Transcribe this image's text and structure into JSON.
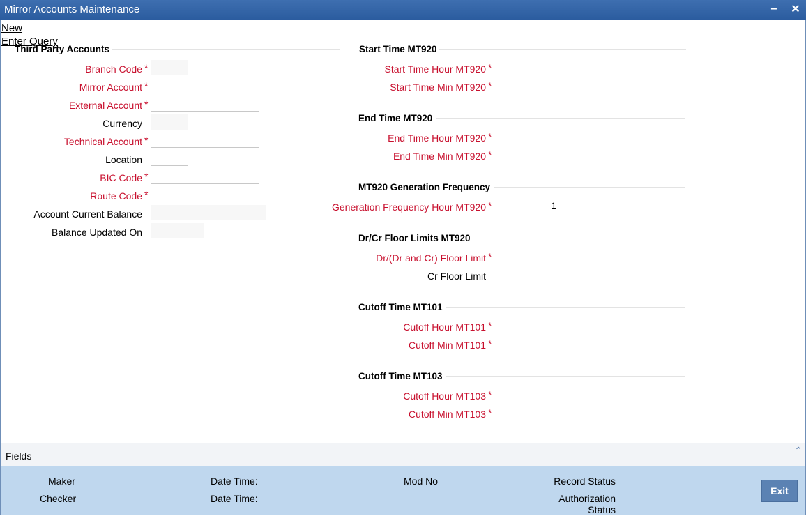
{
  "window": {
    "title": "Mirror Accounts Maintenance"
  },
  "menu": {
    "new_label": "New",
    "enter_query_label": "Enter Query"
  },
  "third_party": {
    "title": "Third Party Accounts",
    "branch_code": {
      "label": "Branch Code",
      "value": ""
    },
    "mirror_account": {
      "label": "Mirror Account",
      "value": ""
    },
    "external_account": {
      "label": "External Account",
      "value": ""
    },
    "currency": {
      "label": "Currency",
      "value": ""
    },
    "technical_account": {
      "label": "Technical Account",
      "value": ""
    },
    "location": {
      "label": "Location",
      "value": ""
    },
    "bic_code": {
      "label": "BIC Code",
      "value": ""
    },
    "route_code": {
      "label": "Route Code",
      "value": ""
    },
    "account_current_balance": {
      "label": "Account Current Balance",
      "value": ""
    },
    "balance_updated_on": {
      "label": "Balance Updated On",
      "value": ""
    }
  },
  "start_time": {
    "title": "Start Time MT920",
    "hour": {
      "label": "Start Time Hour MT920",
      "value": ""
    },
    "min": {
      "label": "Start Time Min MT920",
      "value": ""
    }
  },
  "end_time": {
    "title": "End Time MT920",
    "hour": {
      "label": "End Time Hour MT920",
      "value": ""
    },
    "min": {
      "label": "End Time Min MT920",
      "value": ""
    }
  },
  "generation": {
    "title": "MT920 Generation Frequency",
    "hour": {
      "label": "Generation Frequency Hour MT920",
      "value": "1"
    }
  },
  "floor_limits": {
    "title": "Dr/Cr Floor Limits MT920",
    "dr_limit": {
      "label": "Dr/(Dr and Cr) Floor Limit",
      "value": ""
    },
    "cr_limit": {
      "label": "Cr Floor Limit",
      "value": ""
    }
  },
  "cutoff_101": {
    "title": "Cutoff Time MT101",
    "hour": {
      "label": "Cutoff Hour MT101",
      "value": ""
    },
    "min": {
      "label": "Cutoff Min MT101",
      "value": ""
    }
  },
  "cutoff_103": {
    "title": "Cutoff Time MT103",
    "hour": {
      "label": "Cutoff Hour MT103",
      "value": ""
    },
    "min": {
      "label": "Cutoff Min MT103",
      "value": ""
    }
  },
  "required_marker": "*",
  "fields_bar": {
    "label": "Fields"
  },
  "footer": {
    "maker": "Maker",
    "checker": "Checker",
    "date_time_1": "Date Time:",
    "date_time_2": "Date Time:",
    "mod_no": "Mod No",
    "record_status": "Record Status",
    "authorization_status": "Authorization Status",
    "exit": "Exit"
  },
  "colors": {
    "title_bar": "#2b5c9f",
    "required": "#c8102e",
    "footer": "#bfd7ee",
    "exit_button": "#5b82b3"
  },
  "icons": {
    "minimize": "minimize-icon",
    "close": "close-icon",
    "expand": "chevron-up-icon"
  }
}
